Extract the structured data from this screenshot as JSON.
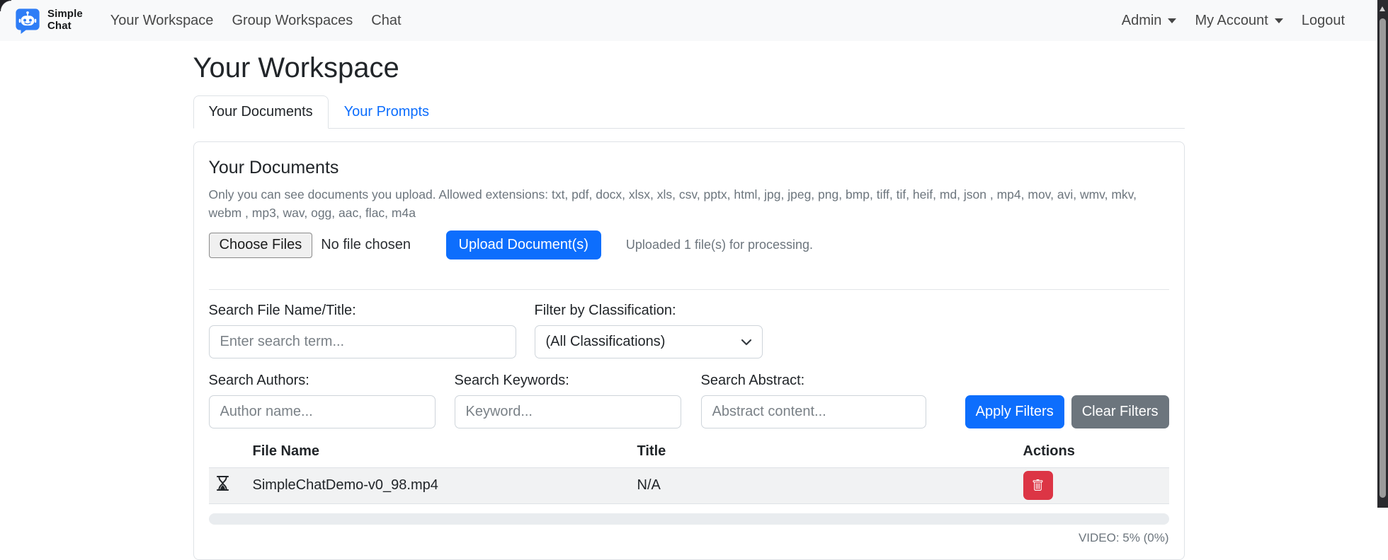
{
  "navbar": {
    "brand": {
      "line1": "Simple",
      "line2": "Chat",
      "icon": "robot-chat-logo-icon",
      "icon_color": "#2e7df6"
    },
    "items": [
      {
        "label": "Your Workspace"
      },
      {
        "label": "Group Workspaces"
      },
      {
        "label": "Chat"
      }
    ],
    "right_items": [
      {
        "label": "Admin",
        "caret": "caret-down-icon"
      },
      {
        "label": "My Account",
        "caret": "caret-down-icon"
      },
      {
        "label": "Logout"
      }
    ]
  },
  "page": {
    "title": "Your Workspace"
  },
  "tabs": [
    {
      "label": "Your Documents",
      "active": true
    },
    {
      "label": "Your Prompts",
      "active": false
    }
  ],
  "documents_card": {
    "heading": "Your Documents",
    "description": "Only you can see documents you upload. Allowed extensions: txt, pdf, docx, xlsx, xls, csv, pptx, html, jpg, jpeg, png, bmp, tiff, tif, heif, md, json , mp4, mov, avi, wmv, mkv, webm , mp3, wav, ogg, aac, flac, m4a",
    "upload": {
      "choose_files_label": "Choose Files",
      "no_file_text": "No file chosen",
      "upload_button_label": "Upload Document(s)",
      "status_text": "Uploaded 1 file(s) for processing."
    },
    "filters": {
      "file_name": {
        "label": "Search File Name/Title:",
        "placeholder": "Enter search term..."
      },
      "classification": {
        "label": "Filter by Classification:",
        "selected": "(All Classifications)"
      },
      "authors": {
        "label": "Search Authors:",
        "placeholder": "Author name..."
      },
      "keywords": {
        "label": "Search Keywords:",
        "placeholder": "Keyword..."
      },
      "abstract": {
        "label": "Search Abstract:",
        "placeholder": "Abstract content..."
      },
      "apply_label": "Apply Filters",
      "clear_label": "Clear Filters"
    },
    "table": {
      "columns": [
        "File Name",
        "Title",
        "Actions"
      ],
      "rows": [
        {
          "status_icon": "hourglass-icon",
          "file_name": "SimpleChatDemo-v0_98.mp4",
          "title": "N/A",
          "action_icon": "trash-icon"
        }
      ]
    },
    "progress": {
      "percent": 0,
      "label": "VIDEO: 5% (0%)"
    }
  },
  "colors": {
    "primary": "#0d6efd",
    "secondary": "#6c757d",
    "danger": "#dc3545",
    "navbar_bg": "#f8f9fa",
    "border": "#dee2e6",
    "muted_text": "#6c757d",
    "row_stripe": "#f1f2f3",
    "progress_track": "#e9ecef"
  }
}
